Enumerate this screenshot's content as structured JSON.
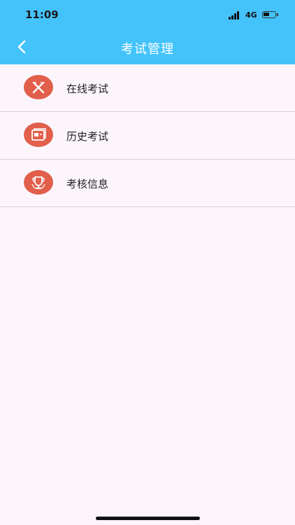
{
  "status_bar": {
    "time": "11:09",
    "network": "4G",
    "battery_level": 0.5
  },
  "header": {
    "title": "考试管理",
    "back_icon": "chevron-left-icon",
    "background_color": "#44c3fb"
  },
  "menu": {
    "accent_color": "#e15f4b",
    "items": [
      {
        "label": "在线考试",
        "icon": "pen-ruler-icon"
      },
      {
        "label": "历史考试",
        "icon": "history-card-icon"
      },
      {
        "label": "考核信息",
        "icon": "trophy-icon"
      }
    ]
  }
}
